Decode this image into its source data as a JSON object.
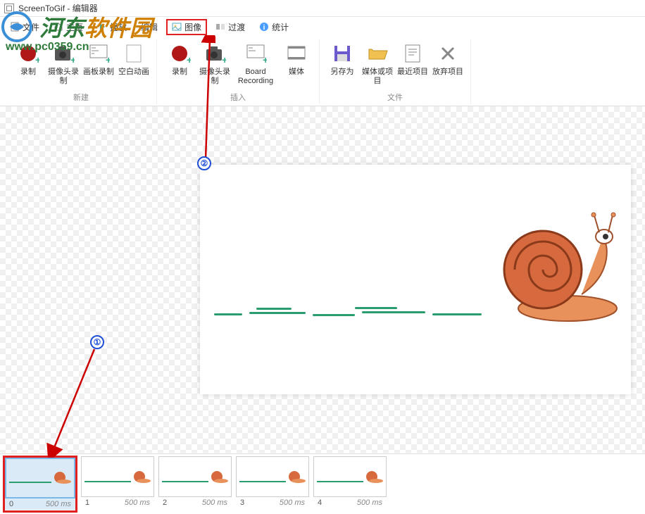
{
  "window": {
    "title": "ScreenToGif - 编辑器"
  },
  "menu": {
    "file": "文件",
    "home": "主页",
    "playback": "播放",
    "edit": "编辑",
    "image": "图像",
    "transition": "过渡",
    "stats": "统计"
  },
  "ribbon": {
    "group_new": {
      "label": "新建",
      "record": "录制",
      "webcam": "摄像头录制",
      "board": "画板录制",
      "blank": "空白动画"
    },
    "group_insert": {
      "label": "插入",
      "record": "录制",
      "webcam": "摄像头录制",
      "board": "Board Recording",
      "media": "媒体"
    },
    "group_file": {
      "label": "文件",
      "saveas": "另存为",
      "mediaproj": "媒体或项目",
      "recent": "最近项目",
      "discard": "放弃项目"
    }
  },
  "timeline": {
    "frames": [
      {
        "index": "0",
        "duration": "500 ms"
      },
      {
        "index": "1",
        "duration": "500 ms"
      },
      {
        "index": "2",
        "duration": "500 ms"
      },
      {
        "index": "3",
        "duration": "500 ms"
      },
      {
        "index": "4",
        "duration": "500 ms"
      }
    ]
  },
  "annotations": {
    "marker1": "①",
    "marker2": "②"
  },
  "watermark": {
    "part1": "河东",
    "part2": "软件园",
    "url": "www.pc0359.cn"
  }
}
